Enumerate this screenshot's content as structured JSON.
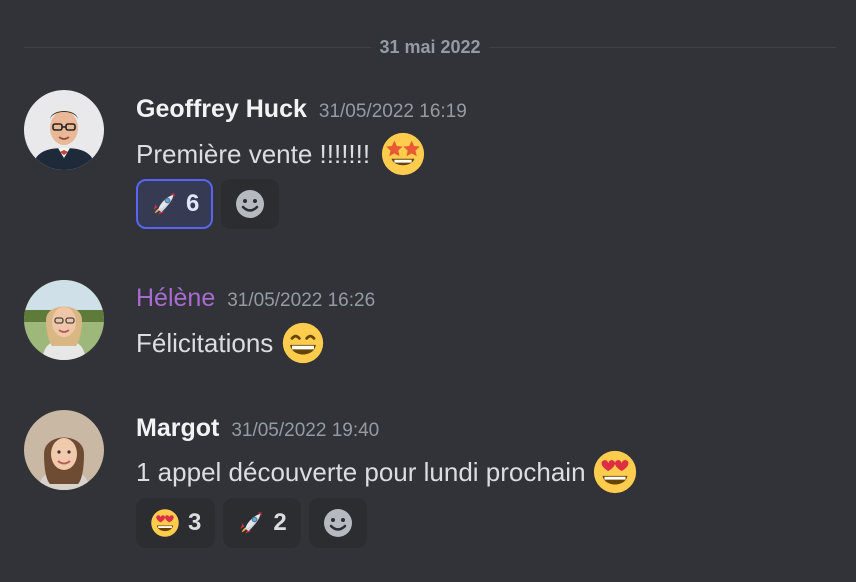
{
  "date_divider": "31 mai 2022",
  "messages": [
    {
      "author": "Geoffrey Huck",
      "timestamp": "31/05/2022 16:19",
      "text": "Première vente !!!!!!!",
      "inline_emoji": "star-struck-emoji",
      "reactions": [
        {
          "emoji": "rocket-emoji",
          "count": "6",
          "active": true
        }
      ]
    },
    {
      "author": "Hélène",
      "author_color": "#a86bd0",
      "timestamp": "31/05/2022 16:26",
      "text": "Félicitations",
      "inline_emoji": "grinning-emoji"
    },
    {
      "author": "Margot",
      "timestamp": "31/05/2022 19:40",
      "text": "1 appel découverte pour lundi prochain",
      "inline_emoji": "heart-eyes-emoji",
      "reactions": [
        {
          "emoji": "heart-eyes-emoji",
          "count": "3",
          "active": false
        },
        {
          "emoji": "rocket-emoji",
          "count": "2",
          "active": false
        }
      ]
    }
  ],
  "colors": {
    "background": "#313338",
    "reaction_active_border": "#5865f2"
  }
}
